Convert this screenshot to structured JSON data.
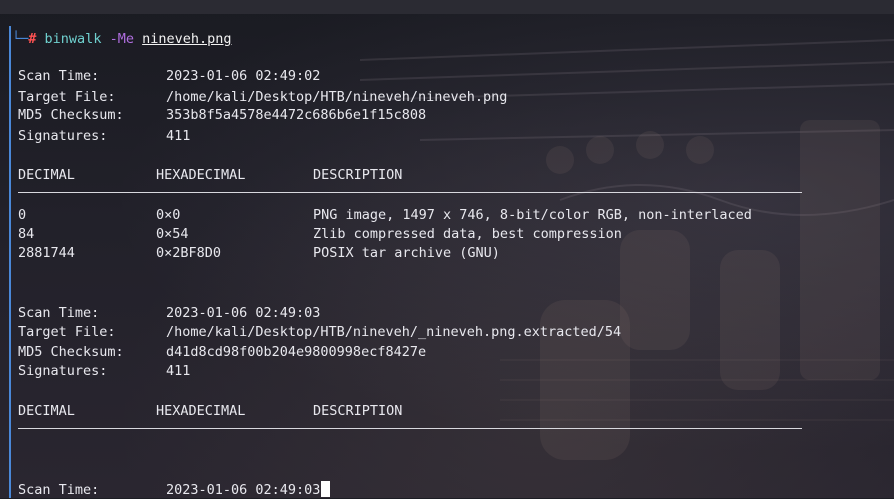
{
  "command": {
    "program": "binwalk",
    "flags": "-Me",
    "argument": "nineveh.png"
  },
  "scans": [
    {
      "scan_time_label": "Scan Time:",
      "scan_time": "2023-01-06 02:49:02",
      "target_label": "Target File:",
      "target": "/home/kali/Desktop/HTB/nineveh/nineveh.png",
      "md5_label": "MD5 Checksum:",
      "md5": "353b8f5a4578e4472c686b6e1f15c808",
      "sig_label": "Signatures:",
      "signatures": "411",
      "headers": [
        "DECIMAL",
        "HEXADECIMAL",
        "DESCRIPTION"
      ],
      "rows": [
        {
          "decimal": "0",
          "hex": "0×0",
          "description": "PNG image, 1497 x 746, 8-bit/color RGB, non-interlaced"
        },
        {
          "decimal": "84",
          "hex": "0×54",
          "description": "Zlib compressed data, best compression"
        },
        {
          "decimal": "2881744",
          "hex": "0×2BF8D0",
          "description": "POSIX tar archive (GNU)"
        }
      ]
    },
    {
      "scan_time_label": "Scan Time:",
      "scan_time": "2023-01-06 02:49:03",
      "target_label": "Target File:",
      "target": "/home/kali/Desktop/HTB/nineveh/_nineveh.png.extracted/54",
      "md5_label": "MD5 Checksum:",
      "md5": "d41d8cd98f00b204e9800998ecf8427e",
      "sig_label": "Signatures:",
      "signatures": "411",
      "headers": [
        "DECIMAL",
        "HEXADECIMAL",
        "DESCRIPTION"
      ]
    },
    {
      "scan_time_label": "Scan Time:",
      "scan_time": "2023-01-06 02:49:03"
    }
  ],
  "colors": {
    "prompt_frame": "#4a88d8",
    "prompt_hash": "#ff5252",
    "command": "#6fd0cf",
    "flags": "#b06ee0"
  }
}
